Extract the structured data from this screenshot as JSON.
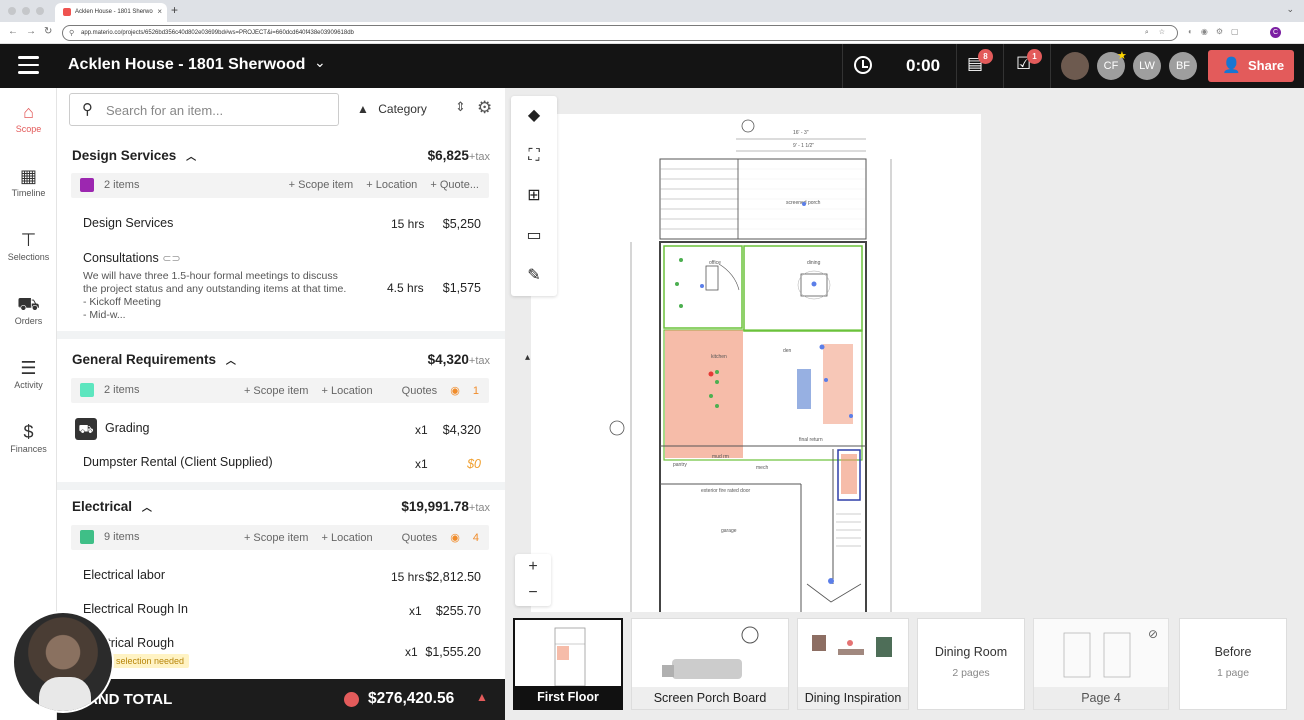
{
  "browser": {
    "tab_title": "Acklen House - 1801 Sherwo",
    "url": "app.materio.co/projects/6526bd356c40d802e03699bd#ws=PROJECT&i=660dcd640f438e03909618db"
  },
  "header": {
    "project_title": "Acklen House - 1801 Sherwood",
    "timer": "0:00",
    "messages_badge": "8",
    "tasks_badge": "1",
    "avatars": [
      "CF",
      "LW",
      "BF"
    ],
    "share_label": "Share"
  },
  "rail": {
    "items": [
      {
        "label": "Scope",
        "icon": "home-icon"
      },
      {
        "label": "Timeline",
        "icon": "calendar-icon"
      },
      {
        "label": "Selections",
        "icon": "paint-roller-icon"
      },
      {
        "label": "Orders",
        "icon": "cart-icon"
      },
      {
        "label": "Activity",
        "icon": "list-icon"
      },
      {
        "label": "Finances",
        "icon": "dollar-icon"
      }
    ]
  },
  "toolbar": {
    "search_placeholder": "Search for an item...",
    "category_label": "Category"
  },
  "sections": [
    {
      "title": "Design Services",
      "amount": "$6,825",
      "tax": "+tax",
      "count": "2 items",
      "swatch": "#9c27b0",
      "actions": [
        "+ Scope item",
        "+ Location",
        "+ Quote..."
      ],
      "items": [
        {
          "name": "Design Services",
          "qty": "15 hrs",
          "amount": "$5,250"
        },
        {
          "name": "Consultations",
          "qty": "4.5 hrs",
          "amount": "$1,575",
          "desc": [
            "We will have three 1.5-hour formal meetings to discuss",
            "the project status and any outstanding items at that time.",
            "- Kickoff Meeting",
            "- Mid-w..."
          ]
        }
      ]
    },
    {
      "title": "General Requirements",
      "amount": "$4,320",
      "tax": "+tax",
      "count": "2 items",
      "swatch": "#5de6bf",
      "actions": [
        "+ Scope item",
        "+ Location"
      ],
      "quotes_label": "Quotes",
      "quotes_count": "1",
      "items": [
        {
          "name": "Grading",
          "qty": "x1",
          "amount": "$4,320"
        },
        {
          "name": "Dumpster Rental (Client Supplied)",
          "qty": "x1",
          "amount": "$0"
        }
      ]
    },
    {
      "title": "Electrical",
      "amount": "$19,991.78",
      "tax": "+tax",
      "count": "9 items",
      "swatch": "#3fbf87",
      "actions": [
        "+ Scope item",
        "+ Location"
      ],
      "quotes_label": "Quotes",
      "quotes_count": "4",
      "items": [
        {
          "name": "Electrical labor",
          "qty": "15 hrs",
          "amount": "$2,812.50"
        },
        {
          "name": "Electrical Rough In",
          "qty": "x1",
          "amount": "$255.70"
        },
        {
          "name": "Electrical Rough",
          "qty": "x1",
          "amount": "$1,555.20",
          "tag": "selection needed"
        }
      ]
    }
  ],
  "grand_total": {
    "label": "AND TOTAL",
    "amount": "$276,420.56"
  },
  "plan_labels": {
    "screened_porch": "screened porch",
    "office": "office",
    "dining": "dining",
    "kitchen": "kitchen",
    "den": "den",
    "garage": "garage",
    "mech": "mech",
    "pantry": "pantry",
    "mud_rm": "mud rm",
    "final_return": "final return",
    "fire_door": "exterior fire rated door",
    "dim_top": "16' - 3\"",
    "dim_top2": "9' - 1 1/2\""
  },
  "thumbnails": [
    {
      "caption": "First Floor",
      "active": true
    },
    {
      "caption": "Screen Porch Board"
    },
    {
      "caption": "Dining Inspiration"
    },
    {
      "title": "Dining Room",
      "pages": "2 pages"
    },
    {
      "caption": "Page 4",
      "hidden": true
    },
    {
      "title": "Before",
      "pages": "1 page"
    }
  ]
}
